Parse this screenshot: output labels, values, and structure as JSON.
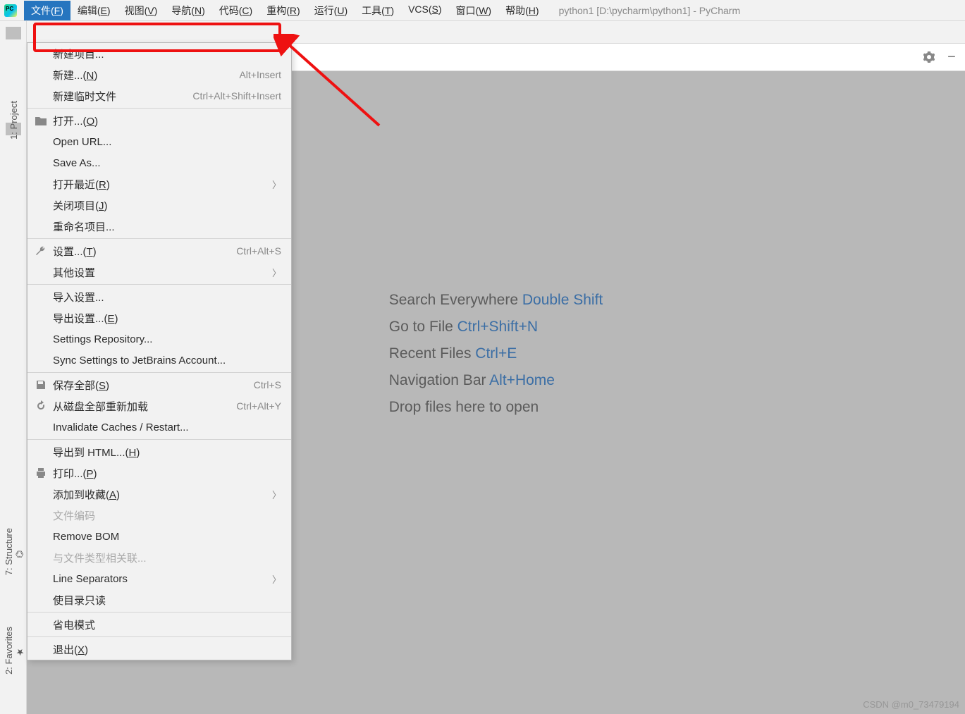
{
  "app": {
    "title": "python1 [D:\\pycharm\\python1] - PyCharm"
  },
  "menubar": [
    {
      "label": "文件",
      "mn": "F",
      "active": true
    },
    {
      "label": "编辑",
      "mn": "E"
    },
    {
      "label": "视图",
      "mn": "V"
    },
    {
      "label": "导航",
      "mn": "N"
    },
    {
      "label": "代码",
      "mn": "C"
    },
    {
      "label": "重构",
      "mn": "R"
    },
    {
      "label": "运行",
      "mn": "U"
    },
    {
      "label": "工具",
      "mn": "T"
    },
    {
      "label": "VCS",
      "mn": "S"
    },
    {
      "label": "窗口",
      "mn": "W"
    },
    {
      "label": "帮助",
      "mn": "H"
    }
  ],
  "rail": {
    "project": "1: Project",
    "structure": "7: Structure",
    "favorites": "2: Favorites"
  },
  "dropdown": [
    {
      "label": "新建项目..."
    },
    {
      "label": "新建...",
      "mn": "N",
      "shortcut": "Alt+Insert"
    },
    {
      "label": "新建临时文件",
      "shortcut": "Ctrl+Alt+Shift+Insert"
    },
    {
      "sep": true
    },
    {
      "label": "打开...",
      "mn": "O",
      "icon": "folder"
    },
    {
      "label": "Open URL..."
    },
    {
      "label": "Save As..."
    },
    {
      "label": "打开最近",
      "mn": "R",
      "submenu": true
    },
    {
      "label": "关闭项目",
      "mn": "J"
    },
    {
      "label": "重命名项目..."
    },
    {
      "sep": true
    },
    {
      "label": "设置...",
      "mn": "T",
      "shortcut": "Ctrl+Alt+S",
      "icon": "wrench"
    },
    {
      "label": "其他设置",
      "submenu": true
    },
    {
      "sep": true
    },
    {
      "label": "导入设置..."
    },
    {
      "label": "导出设置...",
      "mn": "E"
    },
    {
      "label": "Settings Repository..."
    },
    {
      "label": "Sync Settings to JetBrains Account..."
    },
    {
      "sep": true
    },
    {
      "label": "保存全部",
      "mn": "S",
      "shortcut": "Ctrl+S",
      "icon": "save"
    },
    {
      "label": "从磁盘全部重新加载",
      "shortcut": "Ctrl+Alt+Y",
      "icon": "reload"
    },
    {
      "label": "Invalidate Caches / Restart..."
    },
    {
      "sep": true
    },
    {
      "label": "导出到 HTML...",
      "mn": "H"
    },
    {
      "label": "打印...",
      "mn": "P",
      "icon": "print"
    },
    {
      "label": "添加到收藏",
      "mn": "A",
      "submenu": true
    },
    {
      "label": "文件编码",
      "disabled": true
    },
    {
      "label": "Remove BOM"
    },
    {
      "label": "与文件类型相关联...",
      "disabled": true
    },
    {
      "label": "Line Separators",
      "submenu": true
    },
    {
      "label": "使目录只读"
    },
    {
      "sep": true
    },
    {
      "label": "省电模式"
    },
    {
      "sep": true
    },
    {
      "label": "退出",
      "mn": "X"
    }
  ],
  "welcome": {
    "l1a": "Search Everywhere ",
    "l1b": "Double Shift",
    "l2a": "Go to File ",
    "l2b": "Ctrl+Shift+N",
    "l3a": "Recent Files ",
    "l3b": "Ctrl+E",
    "l4a": "Navigation Bar ",
    "l4b": "Alt+Home",
    "l5": "Drop files here to open"
  },
  "watermark": "CSDN @m0_73479194"
}
